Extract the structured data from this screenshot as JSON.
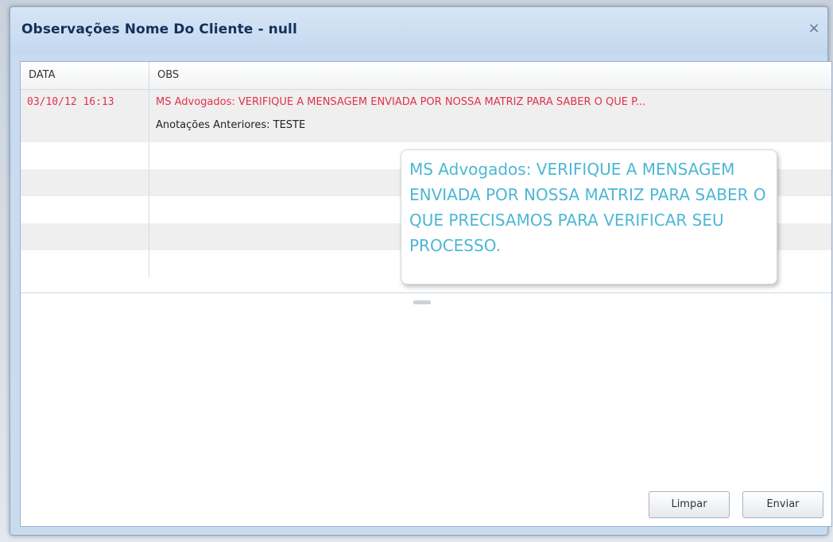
{
  "window": {
    "title": "Observações Nome Do Cliente - null",
    "close_glyph": "×",
    "close_icon": "close-icon"
  },
  "grid": {
    "columns": [
      "DATA",
      "OBS"
    ],
    "rows": [
      {
        "data": "03/10/12  16:13",
        "obs": "MS Advogados: VERIFIQUE A MENSAGEM ENVIADA POR  NOSSA MATRIZ PARA SABER O QUE P...",
        "obs_sub": "Anotações Anteriores: TESTE"
      }
    ],
    "empty_rows": 5,
    "highlight_color": "#e0314b"
  },
  "tooltip": {
    "text": "MS Advogados: VERIFIQUE A MENSAGEM ENVIADA POR  NOSSA MATRIZ PARA SABER O QUE PRECISAMOS PARA VERIFICAR SEU PROCESSO.",
    "color": "#4db7d4"
  },
  "actions": {
    "clear_label": "Limpar",
    "send_label": "Enviar"
  }
}
